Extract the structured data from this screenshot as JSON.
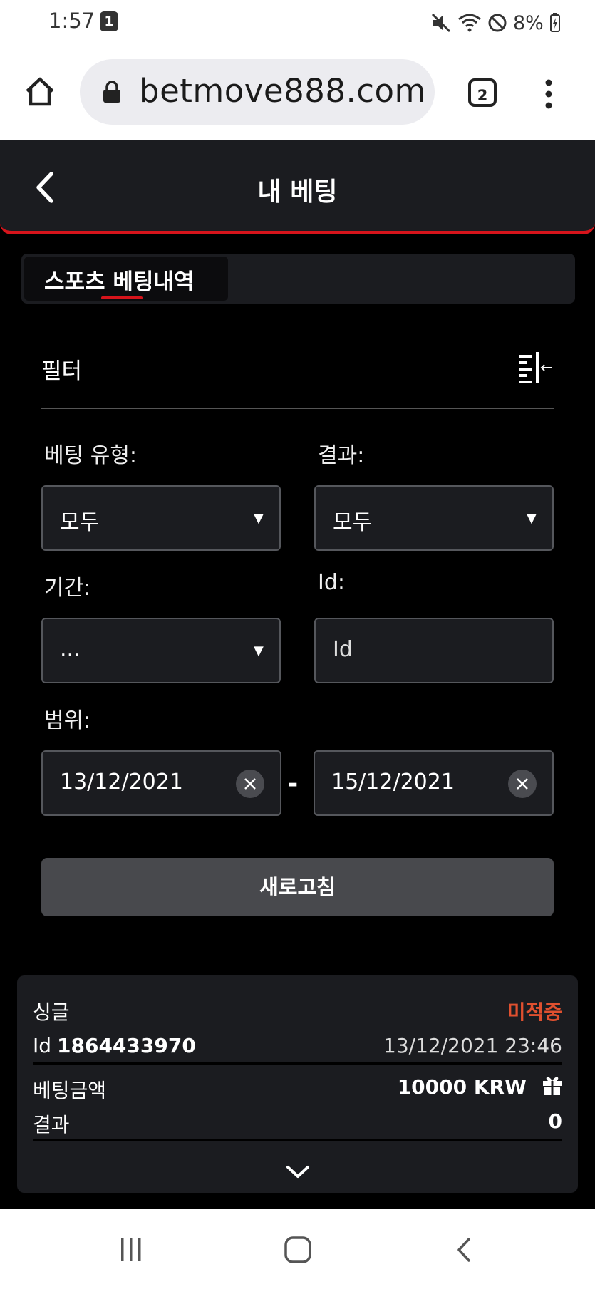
{
  "status_bar": {
    "time": "1:57",
    "notification_count": "1",
    "battery_percent": "8%",
    "icons": [
      "mute-icon",
      "wifi-icon",
      "do-not-disturb-icon",
      "battery-charging-icon"
    ]
  },
  "browser": {
    "url": "betmove888.com/ko",
    "tab_count": "2",
    "icons": [
      "home-icon",
      "lock-icon",
      "more-vert-icon"
    ]
  },
  "header": {
    "title": "내 베팅"
  },
  "tabs": [
    {
      "label": "스포츠 베팅내역",
      "active": true
    }
  ],
  "filter": {
    "title": "필터",
    "bet_type_label": "베팅 유형:",
    "bet_type_value": "모두",
    "result_label": "결과:",
    "result_value": "모두",
    "period_label": "기간:",
    "period_value": "...",
    "id_label": "Id:",
    "id_placeholder": "Id",
    "range_label": "범위:",
    "range_from": "13/12/2021",
    "range_separator": "-",
    "range_to": "15/12/2021",
    "refresh_label": "새로고침"
  },
  "bet": {
    "type": "싱글",
    "status": "미적중",
    "id_prefix": "Id",
    "id_value": "1864433970",
    "datetime": "13/12/2021 23:46",
    "stake_label": "베팅금액",
    "stake_value": "10000 KRW",
    "result_label": "결과",
    "result_value": "0"
  },
  "colors": {
    "accent": "#d6141b",
    "status_lost": "#e0502f",
    "panel": "#1b1c20",
    "background": "#000000"
  }
}
